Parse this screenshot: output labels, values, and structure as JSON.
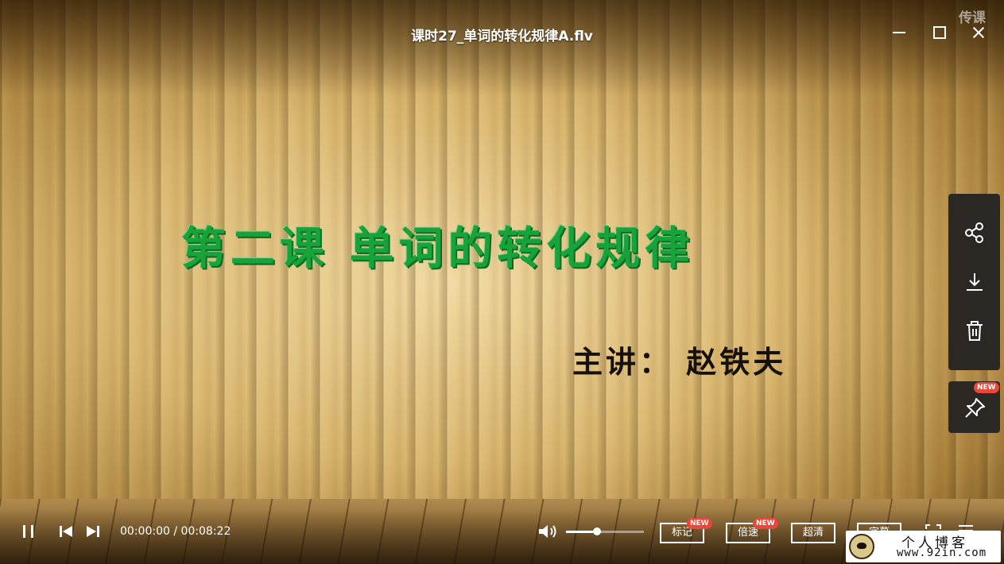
{
  "window": {
    "title": "课时27_单词的转化规律A.flv",
    "watermark": "传课"
  },
  "slide": {
    "title": "第二课  单词的转化规律",
    "lecturer": "主讲：  赵铁夫"
  },
  "side_panel": {
    "items": [
      "share-icon",
      "download-icon",
      "trash-icon"
    ],
    "pin_badge": "NEW"
  },
  "player": {
    "current_time": "00:00:00",
    "total_time": "00:08:22",
    "time_display": "00:00:00 / 00:08:22",
    "volume": 0.4,
    "buttons": {
      "mark": "标记",
      "mark_badge": "NEW",
      "speed": "倍速",
      "speed_badge": "NEW",
      "quality": "超清",
      "subtitle": "字幕"
    }
  },
  "corner_logo": {
    "line1": "个人博客",
    "line2": "www.92in.com"
  },
  "colors": {
    "slide_title": "#18a23a",
    "badge": "#e8473a",
    "panel": "#2b2722"
  }
}
